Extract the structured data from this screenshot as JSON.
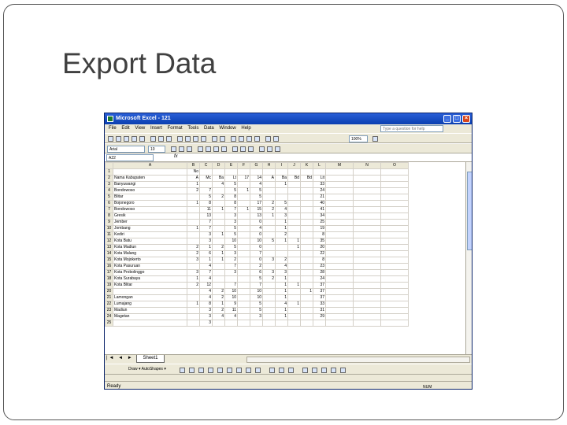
{
  "slide": {
    "title": "Export Data"
  },
  "excel": {
    "title": "Microsoft Excel - 121",
    "window_buttons": [
      "_",
      "□",
      "×"
    ],
    "menu": [
      "File",
      "Edit",
      "View",
      "Insert",
      "Format",
      "Tools",
      "Data",
      "Window",
      "Help"
    ],
    "help_placeholder": "Type a question for help",
    "font_name": "Arial",
    "font_size": "10",
    "zoom": "100%",
    "name_box": "A22",
    "fx": "fx",
    "columns": [
      "A",
      "B",
      "C",
      "D",
      "E",
      "F",
      "G",
      "H",
      "I",
      "J",
      "K",
      "L",
      "M",
      "N",
      "O"
    ],
    "rows": [
      {
        "n": "1",
        "c": [
          "",
          "No",
          "",
          "",
          "",
          "",
          "",
          "",
          "",
          "",
          "",
          "",
          "",
          "",
          ""
        ]
      },
      {
        "n": "2",
        "c": [
          "Nama Kabupaten",
          "A",
          "Mc",
          "Ba",
          "Lt",
          "17",
          "14",
          "A",
          "Ba",
          "Bd",
          "Bd",
          "Lit",
          "",
          "",
          ""
        ]
      },
      {
        "n": "3",
        "c": [
          "Banyuwangi",
          "1",
          "",
          "4",
          "5",
          "",
          "4",
          "",
          "1",
          "",
          "",
          "33",
          "",
          "",
          ""
        ]
      },
      {
        "n": "4",
        "c": [
          "Bondowoso",
          "2",
          "7",
          "",
          "5",
          "1",
          "5",
          "",
          "",
          "",
          "",
          "24",
          "",
          "",
          ""
        ]
      },
      {
        "n": "5",
        "c": [
          "Blitar",
          "",
          "5",
          "2",
          "8",
          "",
          "5",
          "",
          "",
          "",
          "",
          "21",
          "",
          "",
          ""
        ]
      },
      {
        "n": "6",
        "c": [
          "Bojonegoro",
          "1",
          "8",
          "",
          "8",
          "",
          "17",
          "2",
          "5",
          "",
          "",
          "40",
          "",
          "",
          ""
        ]
      },
      {
        "n": "7",
        "c": [
          "Bondowoso",
          "",
          "11",
          "1",
          "7",
          "1",
          "15",
          "2",
          "4",
          "",
          "",
          "41",
          "",
          "",
          ""
        ]
      },
      {
        "n": "8",
        "c": [
          "Gresik",
          "",
          "13",
          "",
          "3",
          "",
          "13",
          "1",
          "3",
          "",
          "",
          "34",
          "",
          "",
          ""
        ]
      },
      {
        "n": "9",
        "c": [
          "Jember",
          "",
          "7",
          "",
          "3",
          "",
          "0",
          "",
          "1",
          "",
          "",
          "25",
          "",
          "",
          ""
        ]
      },
      {
        "n": "10",
        "c": [
          "Jombang",
          "1",
          "7",
          "",
          "5",
          "",
          "4",
          "",
          "1",
          "",
          "",
          "19",
          "",
          "",
          ""
        ]
      },
      {
        "n": "11",
        "c": [
          "Kediri",
          "",
          "3",
          "1",
          "5",
          "",
          "0",
          "",
          "2",
          "",
          "",
          "8",
          "",
          "",
          ""
        ]
      },
      {
        "n": "12",
        "c": [
          "Kota Batu",
          "",
          "3",
          "",
          "10",
          "",
          "10",
          "5",
          "1",
          "1",
          "",
          "35",
          "",
          "",
          ""
        ]
      },
      {
        "n": "13",
        "c": [
          "Kota Madiun",
          "2",
          "1",
          "2",
          "5",
          "",
          "0",
          "",
          "",
          "1",
          "",
          "20",
          "",
          "",
          ""
        ]
      },
      {
        "n": "14",
        "c": [
          "Kota Malang",
          "2",
          "6",
          "1",
          "3",
          "",
          "7",
          "",
          "",
          "",
          "",
          "22",
          "",
          "",
          ""
        ]
      },
      {
        "n": "15",
        "c": [
          "Kota Mojokerto",
          "3",
          "1",
          "1",
          "2",
          "",
          "0",
          "3",
          "2",
          "",
          "",
          "8",
          "",
          "",
          ""
        ]
      },
      {
        "n": "16",
        "c": [
          "Kota Pasuruan",
          "",
          "4",
          "",
          "7",
          "",
          "2",
          "",
          "4",
          "",
          "",
          "23",
          "",
          "",
          ""
        ]
      },
      {
        "n": "17",
        "c": [
          "Kota Probolinggo",
          "3",
          "7",
          "",
          "3",
          "",
          "6",
          "3",
          "3",
          "",
          "",
          "28",
          "",
          "",
          ""
        ]
      },
      {
        "n": "18",
        "c": [
          "Kota Surabaya",
          "1",
          "4",
          "",
          "",
          "",
          "5",
          "2",
          "1",
          "",
          "",
          "24",
          "",
          "",
          ""
        ]
      },
      {
        "n": "19",
        "c": [
          "Kota Blitar",
          "2",
          "12",
          "",
          "7",
          "",
          "7",
          "",
          "1",
          "1",
          "",
          "37",
          "",
          "",
          ""
        ]
      },
      {
        "n": "20",
        "c": [
          "",
          "",
          "4",
          "2",
          "10",
          "",
          "10",
          "",
          "1",
          "",
          "1",
          "37",
          "",
          "",
          ""
        ]
      },
      {
        "n": "21",
        "c": [
          "Lamongan",
          "",
          "4",
          "2",
          "10",
          "",
          "10",
          "",
          "1",
          "",
          "",
          "37",
          "",
          "",
          ""
        ]
      },
      {
        "n": "22",
        "c": [
          "Lumajang",
          "1",
          "8",
          "1",
          "9",
          "",
          "5",
          "",
          "4",
          "1",
          "",
          "33",
          "",
          "",
          ""
        ]
      },
      {
        "n": "23",
        "c": [
          "Madiun",
          "",
          "3",
          "2",
          "11",
          "",
          "5",
          "",
          "1",
          "",
          "",
          "31",
          "",
          "",
          ""
        ]
      },
      {
        "n": "24",
        "c": [
          "Magetan",
          "",
          "3",
          "4",
          "4",
          "",
          "3",
          "",
          "1",
          "",
          "",
          "29",
          "",
          "",
          ""
        ]
      },
      {
        "n": "25",
        "c": [
          "",
          "",
          "3",
          "",
          "",
          "",
          "",
          "",
          "",
          "",
          "",
          "",
          "",
          "",
          ""
        ]
      }
    ],
    "sheet_nav": "|◄ ◄ ► ►|",
    "sheet_tab": "Sheet1",
    "draw_label": "Draw ▾  AutoShapes ▾",
    "status": "Ready",
    "status_num": "NUM"
  }
}
